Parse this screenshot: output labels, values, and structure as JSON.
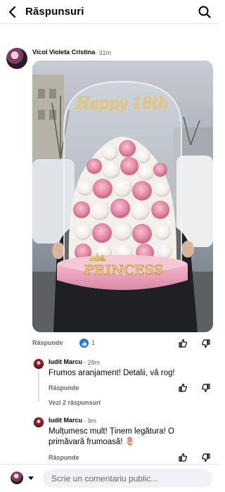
{
  "header": {
    "title": "Răspunsuri",
    "back_icon": "arrow-left-icon",
    "search_icon": "search-icon"
  },
  "comment": {
    "author": "Vicol Violeta Cristina",
    "time": "· 31m",
    "image_text": {
      "topper": "Happy 18th",
      "plaque": "PRINCESS"
    },
    "reply_label": "Răspunde",
    "like_count": "1"
  },
  "replies": [
    {
      "author": "Iudit Marcu",
      "time": "· 28m",
      "text": "Frumos aranjament! Detalii, vă rog!",
      "reply_label": "Răspunde",
      "view_more": "Vezi 2 răspunsuri"
    },
    {
      "author": "Iudit Marcu",
      "time": "· 9m",
      "text": "Mulțumesc mult! Ținem legătura! O primăvară frumoasă! 🌷",
      "reply_label": "Răspunde"
    }
  ],
  "composer": {
    "placeholder": "Scrie un comentariu public..."
  },
  "colors": {
    "accent": "#1877f2",
    "muted": "#65676b",
    "pink_base": "#e89bb5"
  }
}
